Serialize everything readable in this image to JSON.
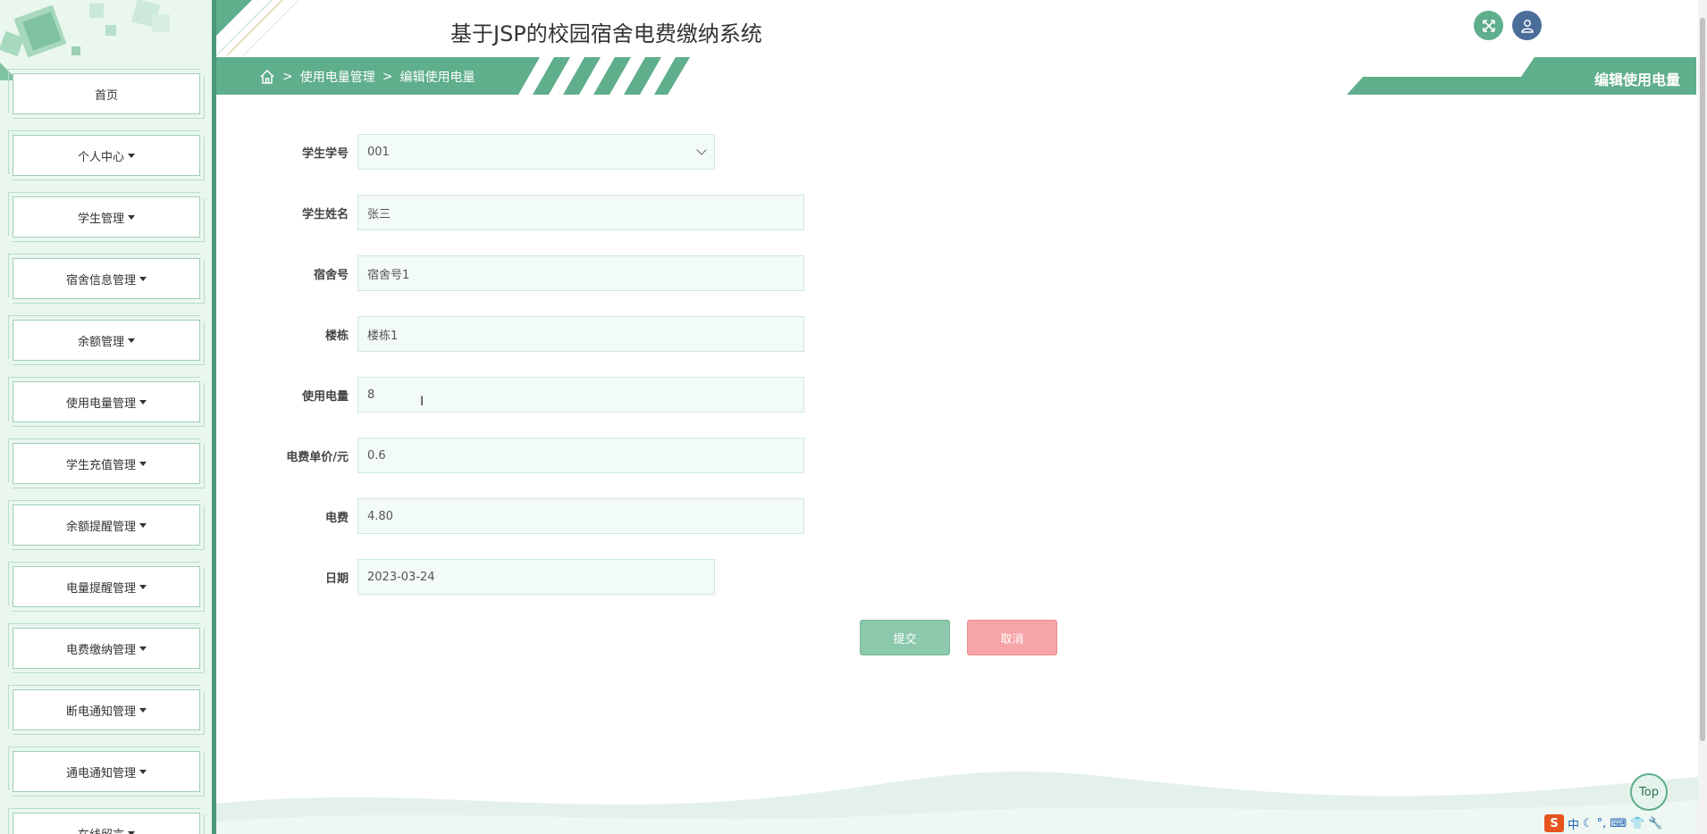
{
  "header": {
    "title": "基于JSP的校园宿舍电费缴纳系统"
  },
  "breadcrumb": {
    "items": [
      "使用电量管理",
      "编辑使用电量"
    ],
    "separator": ">",
    "page_title": "编辑使用电量"
  },
  "sidebar": {
    "items": [
      {
        "label": "首页",
        "dropdown": false
      },
      {
        "label": "个人中心",
        "dropdown": true
      },
      {
        "label": "学生管理",
        "dropdown": true
      },
      {
        "label": "宿舍信息管理",
        "dropdown": true
      },
      {
        "label": "余额管理",
        "dropdown": true
      },
      {
        "label": "使用电量管理",
        "dropdown": true
      },
      {
        "label": "学生充值管理",
        "dropdown": true
      },
      {
        "label": "余额提醒管理",
        "dropdown": true
      },
      {
        "label": "电量提醒管理",
        "dropdown": true
      },
      {
        "label": "电费缴纳管理",
        "dropdown": true
      },
      {
        "label": "断电通知管理",
        "dropdown": true
      },
      {
        "label": "通电通知管理",
        "dropdown": true
      },
      {
        "label": "在线留言",
        "dropdown": true
      }
    ]
  },
  "form": {
    "student_id": {
      "label": "学生学号",
      "value": "001"
    },
    "student_name": {
      "label": "学生姓名",
      "value": "张三"
    },
    "dorm_no": {
      "label": "宿舍号",
      "value": "宿舍号1"
    },
    "building": {
      "label": "楼栋",
      "value": "楼栋1"
    },
    "usage": {
      "label": "使用电量",
      "value": "8"
    },
    "unit_price": {
      "label": "电费单价/元",
      "value": "0.6"
    },
    "fee": {
      "label": "电费",
      "value": "4.80"
    },
    "date": {
      "label": "日期",
      "value": "2023-03-24"
    },
    "submit_label": "提交",
    "cancel_label": "取消"
  },
  "top_button": "Top",
  "tray": {
    "ime": "中"
  },
  "colors": {
    "accent": "#5fae8c",
    "sidebar_bg": "#e9f7ef",
    "cancel": "#f7a4a6",
    "submit": "#8cc8ab"
  }
}
